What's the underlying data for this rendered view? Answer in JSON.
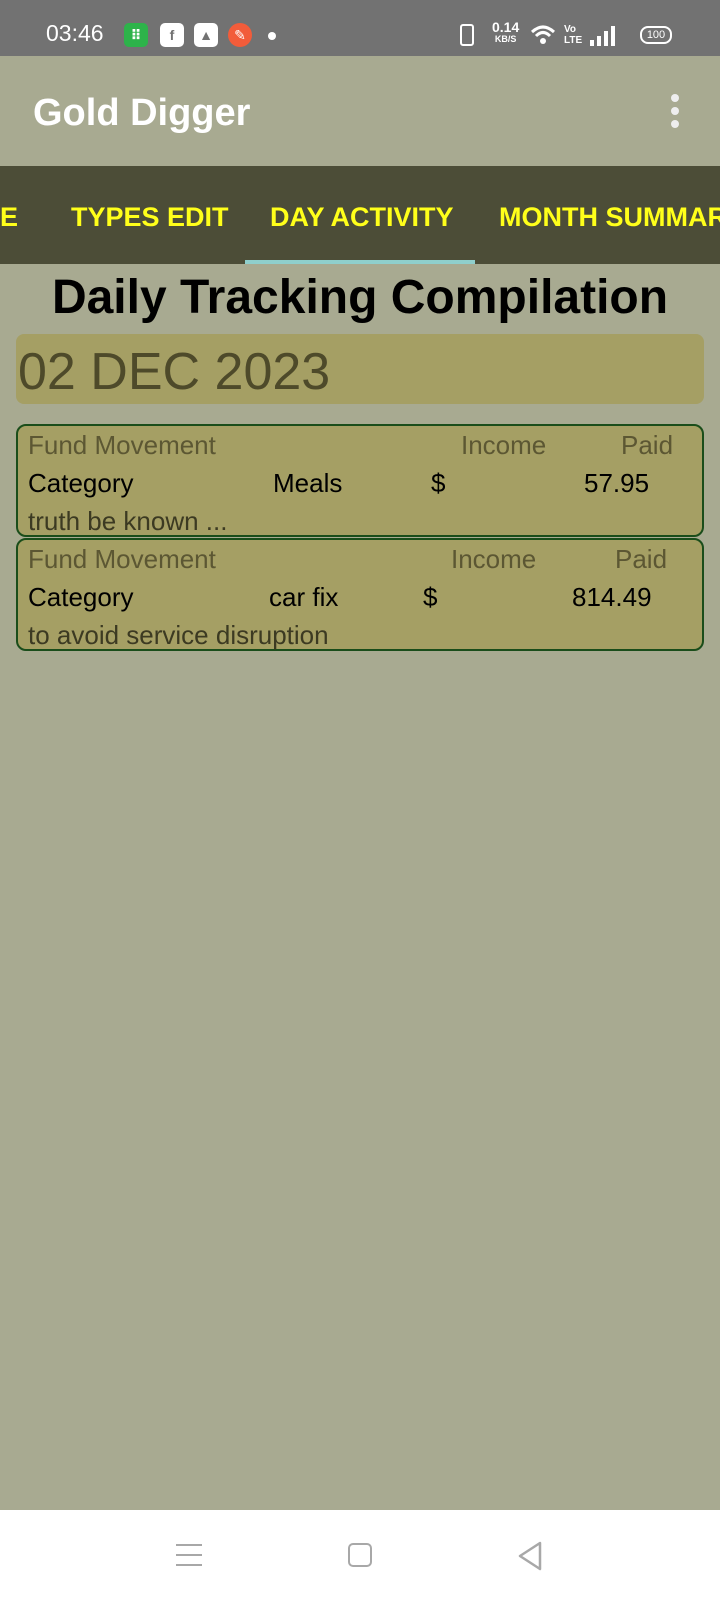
{
  "status_bar": {
    "time": "03:46",
    "speed_value": "0.14",
    "speed_unit": "KB/S",
    "network_label": "Vo LTE",
    "battery": "100",
    "icons": [
      "sim-toolkit-icon",
      "facebook-icon",
      "drive-icon",
      "app-icon",
      "notification-dot-icon",
      "vibrate-icon",
      "wifi-icon",
      "signal-icon",
      "battery-icon"
    ]
  },
  "app_bar": {
    "title": "Gold Digger",
    "menu_icon": "overflow-menu-icon"
  },
  "tabs": [
    {
      "label": "E",
      "active": false
    },
    {
      "label": "TYPES EDIT",
      "active": false
    },
    {
      "label": "DAY ACTIVITY",
      "active": true
    },
    {
      "label": "MONTH SUMMAR",
      "active": false
    }
  ],
  "main": {
    "title": "Daily Tracking Compilation",
    "date": "02 DEC 2023",
    "entries": [
      {
        "fund_label": "Fund Movement",
        "income_label": "Income",
        "paid_label": "Paid",
        "category_label": "Category",
        "category_value": "Meals",
        "currency": "$",
        "amount": "57.95",
        "note": "truth be known ..."
      },
      {
        "fund_label": "Fund Movement",
        "income_label": "Income",
        "paid_label": "Paid",
        "category_label": "Category",
        "category_value": "car fix",
        "currency": "$",
        "amount": "814.49",
        "note": "to avoid service disruption"
      }
    ]
  },
  "colors": {
    "background": "#a8aa91",
    "tab_bar": "#4c4d37",
    "tab_text": "#ffff1a",
    "tab_indicator": "#8fcfcc",
    "card_fill": "#a59f64",
    "card_border": "#1a4d1a"
  },
  "nav_bar": {
    "icons": [
      "menu-icon",
      "home-icon",
      "back-icon"
    ]
  }
}
